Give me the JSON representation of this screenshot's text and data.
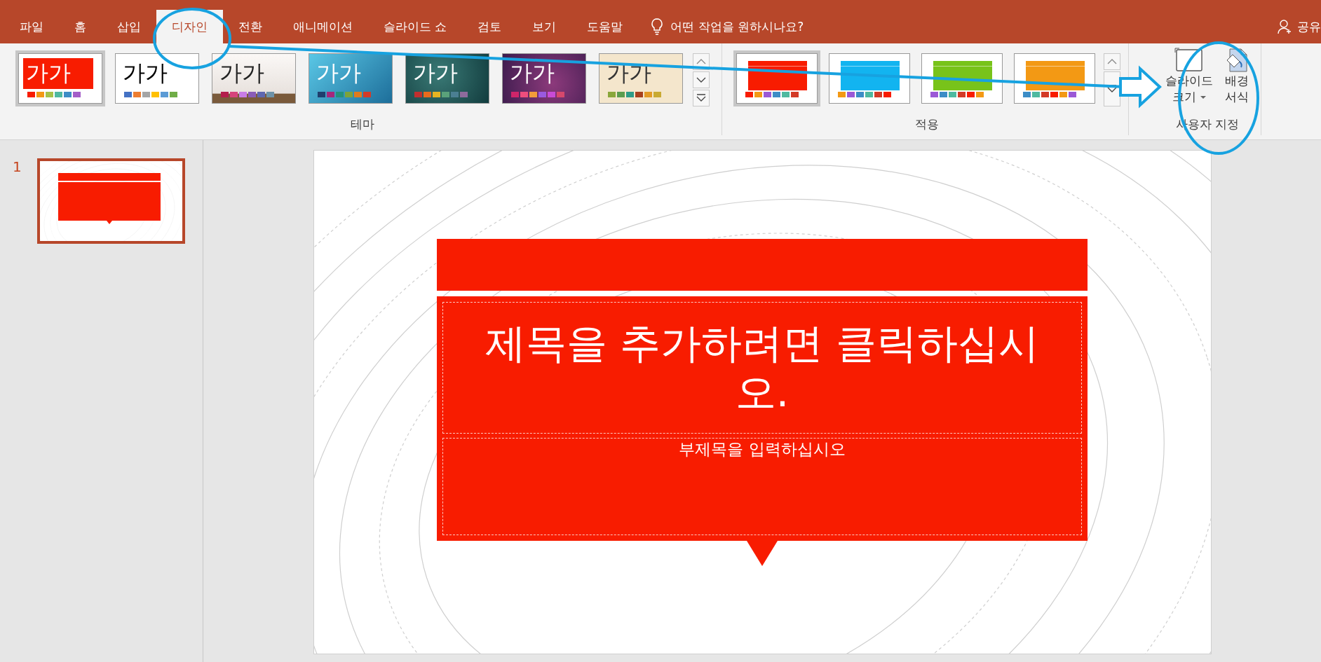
{
  "tabs": [
    {
      "label": "파일",
      "selected": false
    },
    {
      "label": "홈",
      "selected": false
    },
    {
      "label": "삽입",
      "selected": false
    },
    {
      "label": "디자인",
      "selected": true
    },
    {
      "label": "전환",
      "selected": false
    },
    {
      "label": "애니메이션",
      "selected": false
    },
    {
      "label": "슬라이드 쇼",
      "selected": false
    },
    {
      "label": "검토",
      "selected": false
    },
    {
      "label": "보기",
      "selected": false
    },
    {
      "label": "도움말",
      "selected": false
    }
  ],
  "tell_me": "어떤 작업을 원하시나요?",
  "share": "공유",
  "themes": {
    "label": "테마",
    "items": [
      {
        "label": "가가",
        "selected": true,
        "kind": "red"
      },
      {
        "label": "가가",
        "selected": false,
        "kind": "office"
      },
      {
        "label": "가가",
        "selected": false,
        "kind": "wood"
      },
      {
        "label": "가가",
        "selected": false,
        "kind": "blue"
      },
      {
        "label": "가가",
        "selected": false,
        "kind": "teal"
      },
      {
        "label": "가가",
        "selected": false,
        "kind": "purple"
      },
      {
        "label": "가가",
        "selected": false,
        "kind": "paper"
      }
    ]
  },
  "variants": {
    "label": "적용",
    "items": [
      {
        "selected": true,
        "color": "#f81c00"
      },
      {
        "selected": false,
        "color": "#12b4f0"
      },
      {
        "selected": false,
        "color": "#78c31a"
      },
      {
        "selected": false,
        "color": "#f39914"
      }
    ]
  },
  "customize": {
    "label": "사용자 지정",
    "buttons": [
      {
        "kind": "slide-size",
        "lines": [
          "슬라이드",
          "크기"
        ],
        "dropdown": true
      },
      {
        "kind": "background",
        "lines": [
          "배경",
          "서식"
        ],
        "dropdown": false
      }
    ]
  },
  "slides": [
    {
      "number": "1",
      "selected": true
    }
  ],
  "slide": {
    "title": "제목을 추가하려면 클릭하십시오.",
    "subtitle": "부제목을 입력하십시오"
  }
}
